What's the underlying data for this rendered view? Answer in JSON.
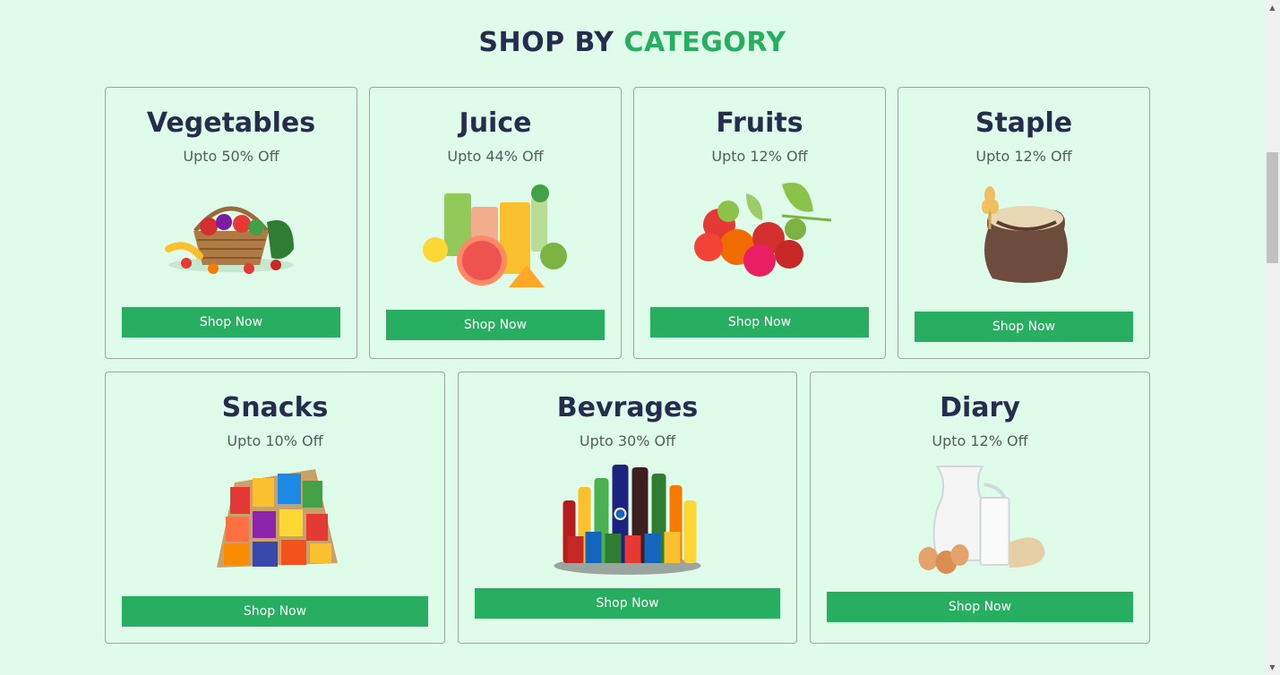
{
  "section": {
    "title_part1": "SHOP BY",
    "title_part2": "CATEGORY"
  },
  "categories": [
    {
      "name": "Vegetables",
      "discount": "Upto 50% Off",
      "button": "Shop Now",
      "icon": "vegetable-basket-icon"
    },
    {
      "name": "Juice",
      "discount": "Upto 44% Off",
      "button": "Shop Now",
      "icon": "juice-glasses-icon"
    },
    {
      "name": "Fruits",
      "discount": "Upto 12% Off",
      "button": "Shop Now",
      "icon": "fruits-icon"
    },
    {
      "name": "Staple",
      "discount": "Upto 12% Off",
      "button": "Shop Now",
      "icon": "grain-sack-icon"
    },
    {
      "name": "Snacks",
      "discount": "Upto 10% Off",
      "button": "Shop Now",
      "icon": "snacks-pile-icon"
    },
    {
      "name": "Bevrages",
      "discount": "Upto 30% Off",
      "button": "Shop Now",
      "icon": "beverage-bottles-icon"
    },
    {
      "name": "Diary",
      "discount": "Upto 12% Off",
      "button": "Shop Now",
      "icon": "milk-eggs-icon"
    }
  ],
  "colors": {
    "background": "#dffbe9",
    "heading": "#262c4e",
    "accent": "#27ae60"
  }
}
